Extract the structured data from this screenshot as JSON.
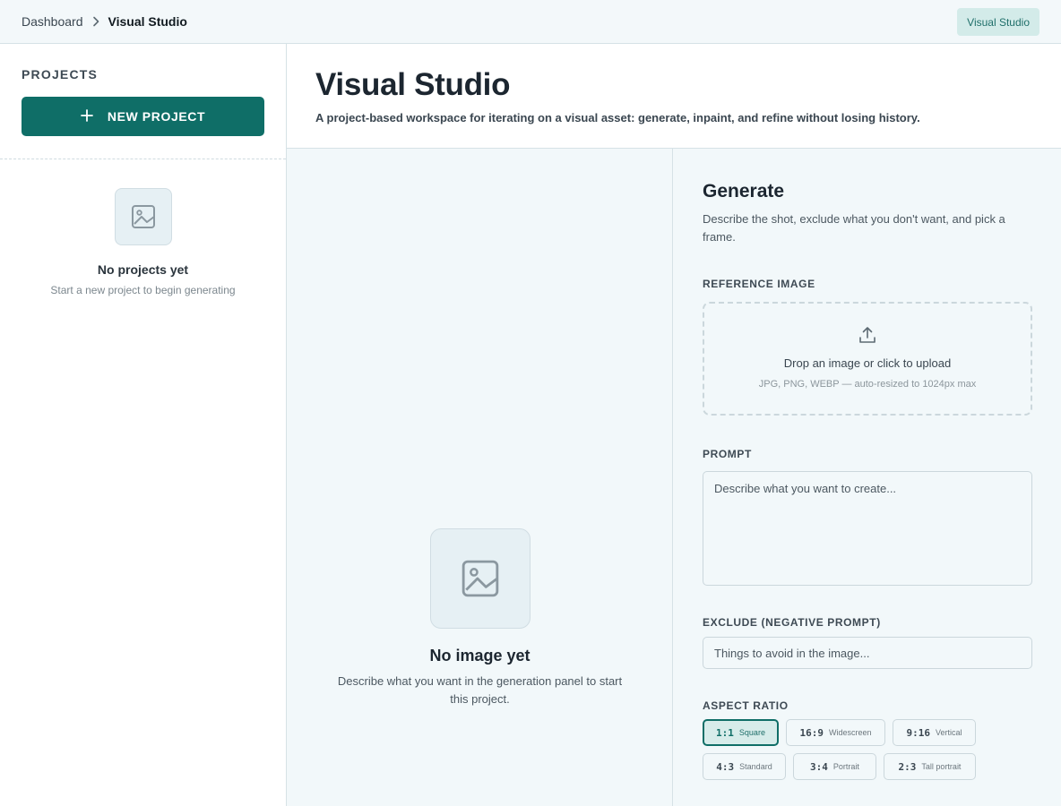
{
  "breadcrumb": {
    "root": "Dashboard",
    "current": "Visual Studio"
  },
  "top_badge": "Visual Studio",
  "sidebar": {
    "title": "PROJECTS",
    "new_project_label": "NEW PROJECT",
    "empty_title": "No projects yet",
    "empty_subtitle": "Start a new project to begin generating"
  },
  "header": {
    "title": "Visual Studio",
    "subtitle": "A project-based workspace for iterating on a visual asset: generate, inpaint, and refine without losing history."
  },
  "canvas": {
    "empty_title": "No image yet",
    "empty_subtitle": "Describe what you want in the generation panel to start this project."
  },
  "generate": {
    "title": "Generate",
    "description": "Describe the shot, exclude what you don't want, and pick a frame.",
    "reference_label": "REFERENCE IMAGE",
    "upload_text": "Drop an image or click to upload",
    "upload_hint": "JPG, PNG, WEBP — auto-resized to 1024px max",
    "prompt_label": "PROMPT",
    "prompt_placeholder": "Describe what you want to create...",
    "exclude_label": "EXCLUDE (NEGATIVE PROMPT)",
    "exclude_placeholder": "Things to avoid in the image...",
    "aspect_label": "ASPECT RATIO",
    "ratios": [
      {
        "code": "1:1",
        "name": "Square",
        "selected": true
      },
      {
        "code": "16:9",
        "name": "Widescreen"
      },
      {
        "code": "9:16",
        "name": "Vertical"
      },
      {
        "code": "4:3",
        "name": "Standard"
      },
      {
        "code": "3:4",
        "name": "Portrait"
      },
      {
        "code": "2:3",
        "name": "Tall portrait"
      }
    ]
  },
  "colors": {
    "accent": "#0f6e67",
    "background": "#f2f8fa",
    "badge_bg": "#d3ebe9"
  },
  "icons": [
    "chevron-right-icon",
    "plus-icon",
    "image-icon",
    "upload-icon"
  ]
}
